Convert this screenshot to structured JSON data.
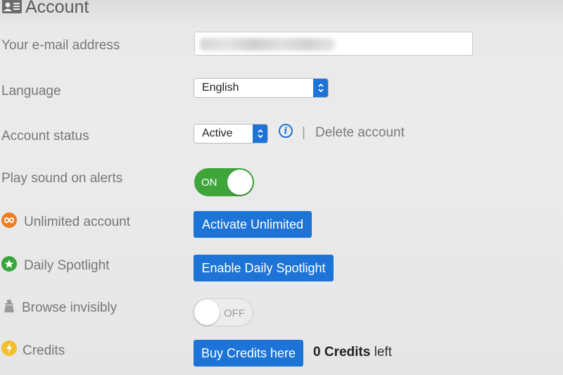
{
  "header": {
    "title": "Account",
    "icon": "contact-card-icon"
  },
  "fields": {
    "email": {
      "label": "Your e-mail address",
      "value": "",
      "placeholder": ""
    },
    "language": {
      "label": "Language",
      "selected": "English"
    },
    "status": {
      "label": "Account status",
      "selected": "Active",
      "info_icon": "info-icon",
      "separator": "|",
      "delete_link": "Delete account"
    },
    "sound": {
      "label": "Play sound on alerts",
      "toggle_state": "ON"
    },
    "unlimited": {
      "label": "Unlimited account",
      "icon": "infinity-icon",
      "icon_color": "#f07d1f",
      "button": "Activate Unlimited"
    },
    "spotlight": {
      "label": "Daily Spotlight",
      "icon": "star-icon",
      "icon_color": "#3aa53b",
      "button": "Enable Daily Spotlight"
    },
    "invisible": {
      "label": "Browse invisibly",
      "icon": "incognito-icon",
      "toggle_state": "OFF"
    },
    "credits": {
      "label": "Credits",
      "icon": "lightning-icon",
      "icon_color": "#f2c02a",
      "button": "Buy Credits here",
      "count_bold": "0 Credits",
      "count_suffix": " left"
    }
  },
  "colors": {
    "accent": "#1e74d6",
    "toggle_on": "#3fa53b"
  }
}
